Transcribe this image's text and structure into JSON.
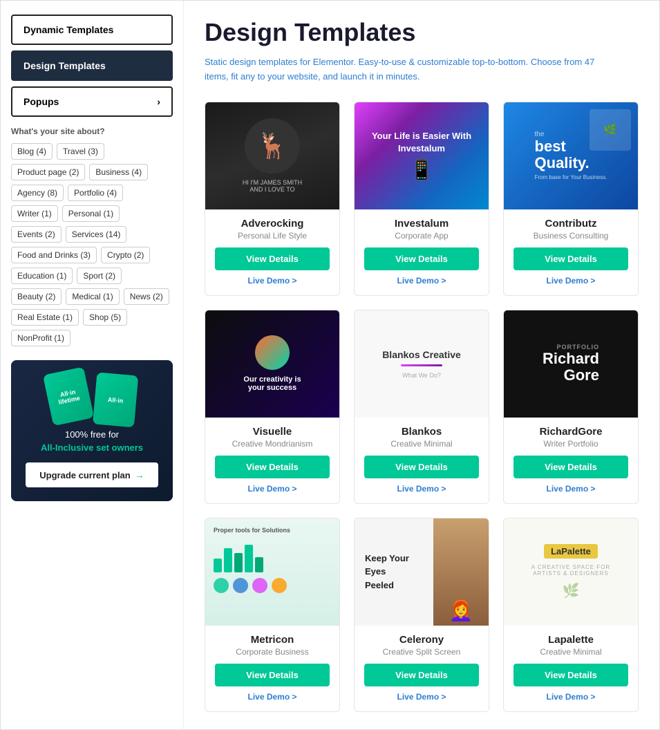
{
  "sidebar": {
    "dynamic_templates_label": "Dynamic Templates",
    "design_templates_label": "Design Templates",
    "popups_label": "Popups",
    "section_label": "What's your site about?",
    "tags": [
      {
        "label": "Blog (4)"
      },
      {
        "label": "Travel (3)"
      },
      {
        "label": "Product page (2)"
      },
      {
        "label": "Business (4)"
      },
      {
        "label": "Agency (8)"
      },
      {
        "label": "Portfolio (4)"
      },
      {
        "label": "Writer (1)"
      },
      {
        "label": "Personal (1)"
      },
      {
        "label": "Events (2)"
      },
      {
        "label": "Services (14)"
      },
      {
        "label": "Food and Drinks (3)"
      },
      {
        "label": "Crypto (2)"
      },
      {
        "label": "Education (1)"
      },
      {
        "label": "Sport (2)"
      },
      {
        "label": "Beauty (2)"
      },
      {
        "label": "Medical (1)"
      },
      {
        "label": "News (2)"
      },
      {
        "label": "Real Estate (1)"
      },
      {
        "label": "Shop (5)"
      },
      {
        "label": "NonProfit (1)"
      }
    ],
    "promo": {
      "line1": "100% free for",
      "highlight": "All-Inclusive set owners",
      "button_label": "Upgrade current plan"
    }
  },
  "main": {
    "title": "Design Templates",
    "description": "Static design templates for Elementor. Easy-to-use & customizable top-to-bottom. Choose from 47 items, fit any to your website, and launch it in minutes.",
    "templates": [
      {
        "name": "Adverocking",
        "category": "Personal Life Style",
        "view_label": "View Details",
        "demo_label": "Live Demo >"
      },
      {
        "name": "Investalum",
        "category": "Corporate App",
        "view_label": "View Details",
        "demo_label": "Live Demo >"
      },
      {
        "name": "Contributz",
        "category": "Business Consulting",
        "view_label": "View Details",
        "demo_label": "Live Demo >"
      },
      {
        "name": "Visuelle",
        "category": "Creative Mondrianism",
        "view_label": "View Details",
        "demo_label": "Live Demo >"
      },
      {
        "name": "Blankos",
        "category": "Creative Minimal",
        "view_label": "View Details",
        "demo_label": "Live Demo >"
      },
      {
        "name": "RichardGore",
        "category": "Writer Portfolio",
        "view_label": "View Details",
        "demo_label": "Live Demo >"
      },
      {
        "name": "Metricon",
        "category": "Corporate Business",
        "view_label": "View Details",
        "demo_label": "Live Demo >"
      },
      {
        "name": "Celerony",
        "category": "Creative Split Screen",
        "view_label": "View Details",
        "demo_label": "Live Demo >"
      },
      {
        "name": "Lapalette",
        "category": "Creative Minimal",
        "view_label": "View Details",
        "demo_label": "Live Demo >"
      }
    ]
  }
}
